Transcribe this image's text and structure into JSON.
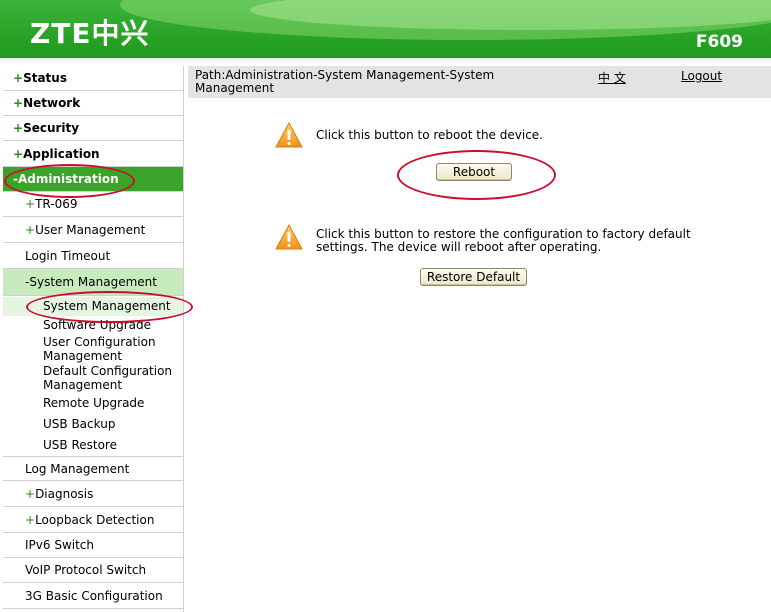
{
  "header": {
    "logo": "ZTE中兴",
    "model": "F609"
  },
  "sidebar": {
    "top": [
      {
        "sign": "+",
        "label": "Status"
      },
      {
        "sign": "+",
        "label": "Network"
      },
      {
        "sign": "+",
        "label": "Security"
      },
      {
        "sign": "+",
        "label": "Application"
      },
      {
        "sign": "-",
        "label": "Administration"
      }
    ],
    "admin_children": [
      {
        "sign": "+",
        "label": "TR-069"
      },
      {
        "sign": "+",
        "label": "User Management"
      },
      {
        "sign": "",
        "label": "Login Timeout"
      },
      {
        "sign": "-",
        "label": "System Management"
      }
    ],
    "sysmgmt_children": [
      "System Management",
      "Software Upgrade",
      "User Configuration Management",
      "Default Configuration Management",
      "Remote Upgrade",
      "USB Backup",
      "USB Restore"
    ],
    "more": [
      {
        "sign": "",
        "label": "Log Management"
      },
      {
        "sign": "+",
        "label": "Diagnosis"
      },
      {
        "sign": "+",
        "label": "Loopback Detection"
      },
      {
        "sign": "",
        "label": "IPv6 Switch"
      },
      {
        "sign": "",
        "label": "VoIP Protocol Switch"
      },
      {
        "sign": "",
        "label": "3G Basic Configuration"
      }
    ]
  },
  "pathbar": {
    "path": "Path:Administration-System Management-System Management",
    "lang": "中 文",
    "logout": "Logout"
  },
  "reboot": {
    "message": "Click this button to reboot the device.",
    "button": "Reboot"
  },
  "restore": {
    "message": "Click this button to restore the configuration to factory default settings. The device will reboot after operating.",
    "button": "Restore Default"
  },
  "colors": {
    "accent_green": "#3aa428",
    "highlight_circle": "#c8102e",
    "warning_icon": "#f5a01a"
  }
}
